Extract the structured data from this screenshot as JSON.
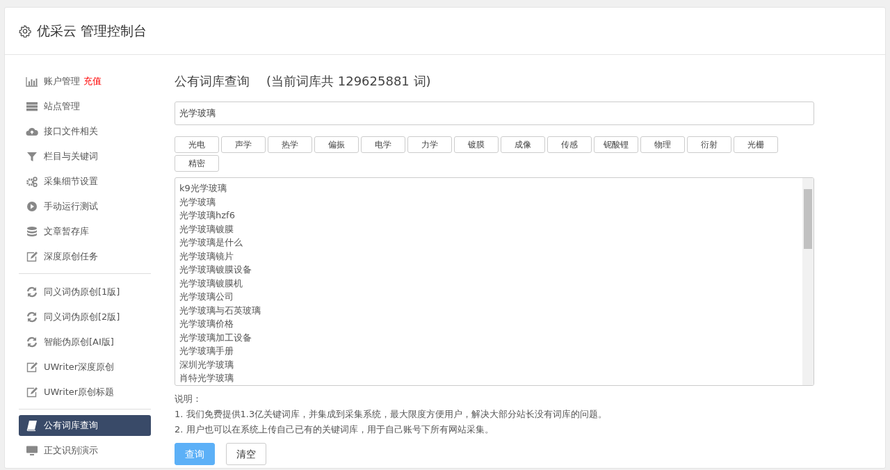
{
  "header": {
    "title": "优采云 管理控制台"
  },
  "sidebar": {
    "groups": [
      {
        "items": [
          {
            "label": "账户管理",
            "extra": "充值",
            "selected": false
          },
          {
            "label": "站点管理",
            "selected": false
          },
          {
            "label": "接口文件相关",
            "selected": false
          },
          {
            "label": "栏目与关键词",
            "selected": false
          },
          {
            "label": "采集细节设置",
            "selected": false
          },
          {
            "label": "手动运行测试",
            "selected": false
          },
          {
            "label": "文章暂存库",
            "selected": false
          },
          {
            "label": "深度原创任务",
            "selected": false
          }
        ]
      },
      {
        "items": [
          {
            "label": "同义词伪原创[1版]",
            "selected": false
          },
          {
            "label": "同义词伪原创[2版]",
            "selected": false
          },
          {
            "label": "智能伪原创[AI版]",
            "selected": false
          },
          {
            "label": "UWriter深度原创",
            "selected": false
          },
          {
            "label": "UWriter原创标题",
            "selected": false
          }
        ]
      },
      {
        "items": [
          {
            "label": "公有词库查询",
            "selected": true
          },
          {
            "label": "正文识别演示",
            "selected": false
          }
        ]
      }
    ]
  },
  "main": {
    "title": "公有词库查询",
    "subtitle": "(当前词库共 129625881 词)",
    "search": {
      "value": "光学玻璃"
    },
    "tags": [
      "光电",
      "声学",
      "热学",
      "偏振",
      "电学",
      "力学",
      "镀膜",
      "成像",
      "传感",
      "铌酸锂",
      "物理",
      "衍射",
      "光栅",
      "精密"
    ],
    "results": [
      "k9光学玻璃",
      "光学玻璃",
      "光学玻璃hzf6",
      "光学玻璃镀膜",
      "光学玻璃是什么",
      "光学玻璃镜片",
      "光学玻璃镀膜设备",
      "光学玻璃镀膜机",
      "光学玻璃公司",
      "光学玻璃与石英玻璃",
      "光学玻璃价格",
      "光学玻璃加工设备",
      "光学玻璃手册",
      "深圳光学玻璃",
      "肖特光学玻璃"
    ],
    "notes_title": "说明：",
    "notes": [
      "1. 我们免费提供1.3亿关键词库，并集成到采集系统，最大限度方便用户，解决大部分站长没有词库的问题。",
      "2. 用户也可以在系统上传自己已有的关键词库，用于自己账号下所有网站采集。"
    ],
    "buttons": [
      {
        "kind": "primary",
        "label": "查询"
      },
      {
        "kind": "default",
        "label": "清空"
      }
    ]
  }
}
